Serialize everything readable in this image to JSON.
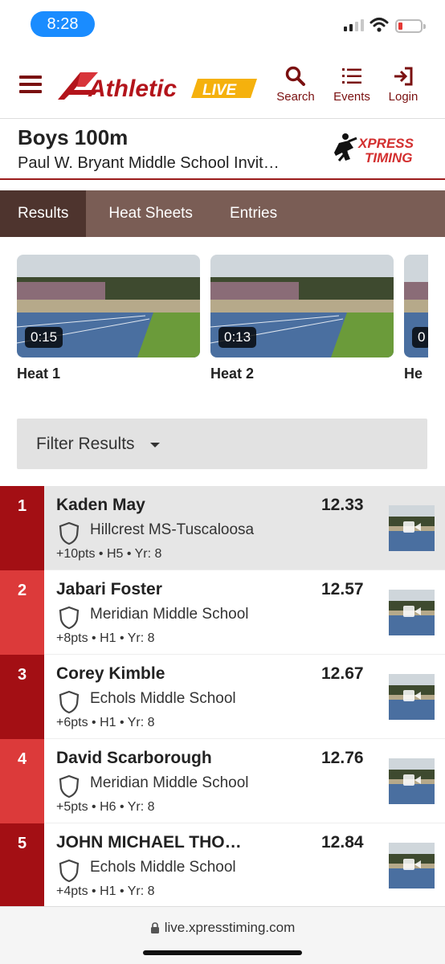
{
  "status_bar": {
    "time": "8:28"
  },
  "header": {
    "logo_text": "Athletic",
    "logo_live": "LIVE",
    "search_label": "Search",
    "events_label": "Events",
    "login_label": "Login"
  },
  "event": {
    "title": "Boys 100m",
    "meet": "Paul W. Bryant Middle School Invit…",
    "timer_logo_top": "XPRESS",
    "timer_logo_bottom": "TIMING"
  },
  "tabs": [
    {
      "label": "Results",
      "active": true
    },
    {
      "label": "Heat Sheets",
      "active": false
    },
    {
      "label": "Entries",
      "active": false
    }
  ],
  "videos": [
    {
      "duration": "0:15",
      "label": "Heat 1"
    },
    {
      "duration": "0:13",
      "label": "Heat 2"
    },
    {
      "duration": "0",
      "label": "He"
    }
  ],
  "filter": {
    "label": "Filter Results"
  },
  "results": [
    {
      "place": "1",
      "name": "Kaden May",
      "school": "Hillcrest MS-Tuscaloosa",
      "meta": "+10pts • H5 • Yr: 8",
      "mark": "12.33"
    },
    {
      "place": "2",
      "name": "Jabari Foster",
      "school": "Meridian Middle School",
      "meta": "+8pts • H1 • Yr: 8",
      "mark": "12.57"
    },
    {
      "place": "3",
      "name": "Corey Kimble",
      "school": "Echols Middle School",
      "meta": "+6pts • H1 • Yr: 8",
      "mark": "12.67"
    },
    {
      "place": "4",
      "name": "David Scarborough",
      "school": "Meridian Middle School",
      "meta": "+5pts • H6 • Yr: 8",
      "mark": "12.76"
    },
    {
      "place": "5",
      "name": "JOHN MICHAEL THO…",
      "school": "Echols Middle School",
      "meta": "+4pts • H1 • Yr: 8",
      "mark": "12.84"
    }
  ],
  "browser": {
    "url": "live.xpresstiming.com"
  },
  "colors": {
    "brand_red": "#a30f14",
    "tab_bg": "#7a5d55",
    "tab_active": "#4e342e",
    "accent_blue": "#1a8cff"
  }
}
